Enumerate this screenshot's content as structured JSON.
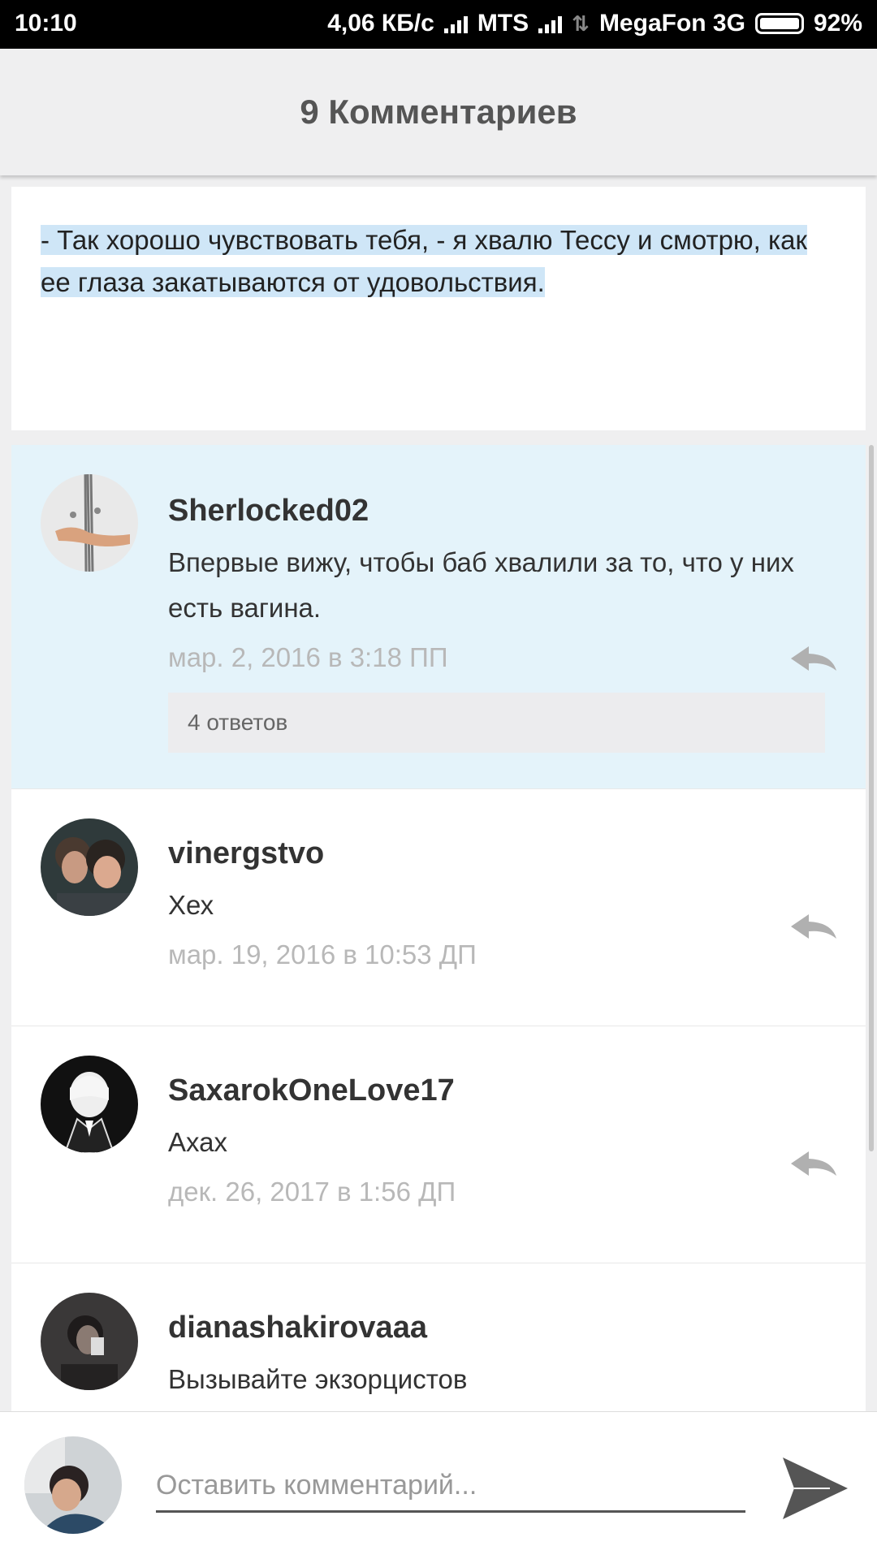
{
  "status_bar": {
    "time": "10:10",
    "speed": "4,06 КБ/с",
    "carrier1": "MTS",
    "carrier2": "MegaFon 3G",
    "battery": "92%"
  },
  "header": {
    "title": "9 Комментариев"
  },
  "quote": {
    "text": "- Так хорошо чувствовать тебя, - я хвалю Тессу и смотрю, как ее глаза закатываются от удовольствия."
  },
  "comments": [
    {
      "username": "Sherlocked02",
      "text": "Впервые вижу, чтобы баб хвалили за то, что у них есть вагина.",
      "date": "мар. 2, 2016 в 3:18 ПП",
      "replies": "4 ответов"
    },
    {
      "username": "vinergstvo",
      "text": "Хех",
      "date": "мар. 19, 2016 в 10:53 ДП"
    },
    {
      "username": "SaxarokOneLove17",
      "text": "Ахах",
      "date": "дек. 26, 2017 в 1:56 ДП"
    },
    {
      "username": "dianashakirovaaa",
      "text": "Вызывайте экзорцистов"
    }
  ],
  "composer": {
    "placeholder": "Оставить комментарий..."
  },
  "colors": {
    "highlight_bg": "#e4f3fa",
    "selection": "#cfe6f7",
    "date": "#b8b8b8"
  }
}
